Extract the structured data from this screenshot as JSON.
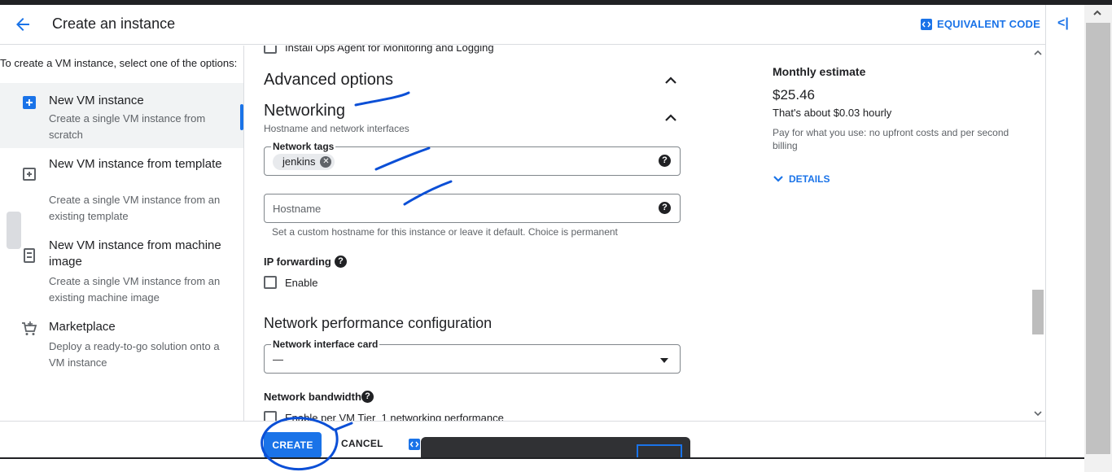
{
  "header": {
    "title": "Create an instance",
    "equivalent_code": "EQUIVALENT CODE"
  },
  "left": {
    "intro": "To create a VM instance, select one of the options:",
    "options": [
      {
        "title": "New VM instance",
        "desc": "Create a single VM instance from scratch"
      },
      {
        "title": "New VM instance from template",
        "desc": "Create a single VM instance from an existing template"
      },
      {
        "title": "New VM instance from machine image",
        "desc": "Create a single VM instance from an existing machine image"
      },
      {
        "title": "Marketplace",
        "desc": "Deploy a ready-to-go solution onto a VM instance"
      }
    ]
  },
  "main": {
    "ops_agent": "Install Ops Agent for Monitoring and Logging",
    "advanced": "Advanced options",
    "networking": "Networking",
    "networking_sub": "Hostname and network interfaces",
    "network_tags_label": "Network tags",
    "network_tag_chip": "jenkins",
    "hostname_placeholder": "Hostname",
    "hostname_hint": "Set a custom hostname for this instance or leave it default. Choice is permanent",
    "ip_forwarding": "IP forwarding",
    "ip_enable": "Enable",
    "perf_config": "Network performance configuration",
    "nic_label": "Network interface card",
    "nic_value": "—",
    "bandwidth": "Network bandwidth",
    "tier1": "Enable per VM Tier_1 networking performance"
  },
  "estimate": {
    "label": "Monthly estimate",
    "price": "$25.46",
    "hourly": "That's about $0.03 hourly",
    "note": "Pay for what you use: no upfront costs and per second billing",
    "details": "DETAILS"
  },
  "footer": {
    "create": "CREATE",
    "cancel": "CANCEL"
  },
  "colors": {
    "accent": "#1a73e8",
    "annotation_ink": "#0b4fd6"
  }
}
